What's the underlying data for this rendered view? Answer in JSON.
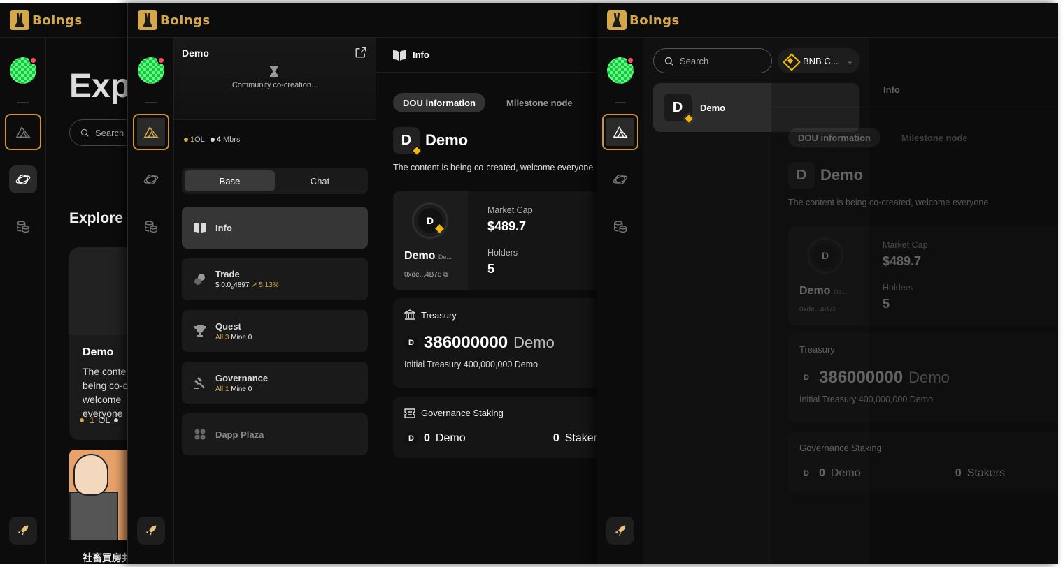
{
  "app": {
    "brand": "Boings"
  },
  "explore": {
    "title": "Exp",
    "search_placeholder": "Search",
    "subtitle": "Explore D",
    "card": {
      "name": "Demo",
      "desc": "The content is being co-created, welcome everyone",
      "ol_count": "1",
      "ol_label": "OL"
    },
    "card2_title": "社畜買房共"
  },
  "dou": {
    "name": "Demo",
    "community": "Community co-creation...",
    "ol_count": "1",
    "ol_label": "OL",
    "members_count": "4",
    "members_label": "Mbrs",
    "segments": [
      "Base",
      "Chat"
    ],
    "nav": {
      "info": "Info",
      "trade": "Trade",
      "trade_price_prefix": "$ 0.0",
      "trade_price_sub": "6",
      "trade_price_rest": "4897",
      "trade_change": "↗ 5.13%",
      "quest": "Quest",
      "quest_all_label": "All",
      "quest_all": "3",
      "quest_mine_label": "Mine",
      "quest_mine": "0",
      "governance": "Governance",
      "gov_all_label": "All",
      "gov_all": "1",
      "gov_mine_label": "Mine",
      "gov_mine": "0",
      "dapp": "Dapp Plaza"
    }
  },
  "info": {
    "header": "Info",
    "tabs": [
      "DOU information",
      "Milestone node"
    ],
    "badge_letter": "D",
    "title": "Demo",
    "description": "The content is being co-created, welcome everyone",
    "token_name": "Demo",
    "token_symbol_short": "De...",
    "address": "0xde...4B78",
    "market_cap_label": "Market Cap",
    "market_cap": "$489.7",
    "holders_label": "Holders",
    "holders": "5",
    "treasury_label": "Treasury",
    "treasury_amount": "386000000",
    "treasury_unit": "Demo",
    "treasury_initial": "Initial Treasury 400,000,000 Demo",
    "staking_label": "Governance Staking",
    "staked_amount": "0",
    "staked_unit": "Demo",
    "stakers_count": "0",
    "stakers_label": "Stakers"
  },
  "selector": {
    "search_placeholder": "Search",
    "chain": "BNB C...",
    "items": [
      {
        "letter": "D",
        "name": "Demo"
      }
    ]
  },
  "colors": {
    "accent": "#d4a84a",
    "bnb": "#f0b90b",
    "bg": "#0c0c0c",
    "notify": "#ff4d5a"
  }
}
